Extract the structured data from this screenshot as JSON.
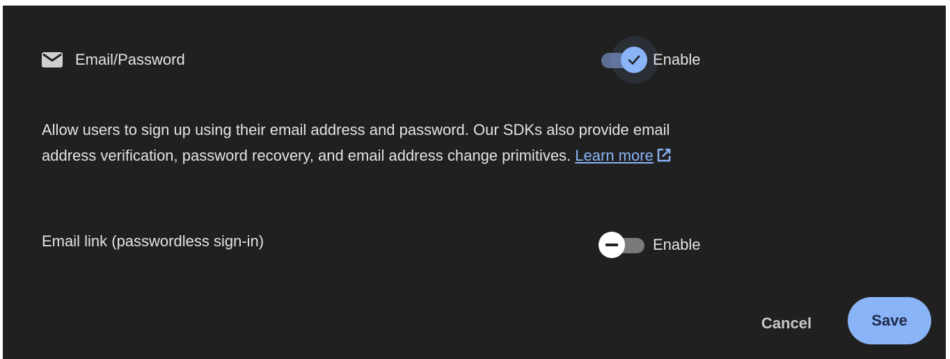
{
  "provider": {
    "icon": "mail-icon",
    "name": "Email/Password",
    "toggle": {
      "state": "on",
      "label": "Enable"
    }
  },
  "description": {
    "text": "Allow users to sign up using their email address and password. Our SDKs also provide email address verification, password recovery, and email address change primitives.",
    "link_text": "Learn more",
    "link_icon": "external-link-icon"
  },
  "email_link": {
    "label": "Email link (passwordless sign-in)",
    "toggle": {
      "state": "off",
      "label": "Enable"
    }
  },
  "actions": {
    "cancel_label": "Cancel",
    "save_label": "Save"
  },
  "colors": {
    "background": "#202020",
    "accent": "#8ab4f8",
    "text": "#e3e3e3"
  }
}
